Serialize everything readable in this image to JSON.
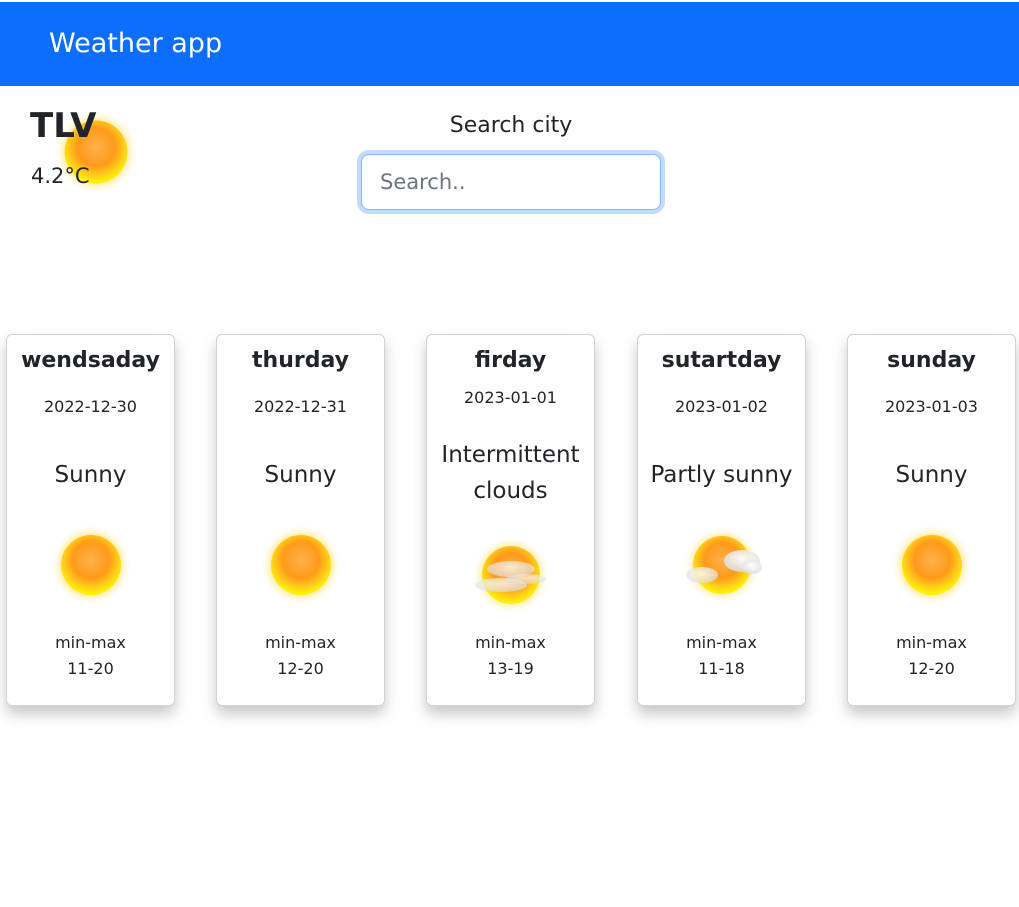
{
  "navbar": {
    "brand": "Weather app"
  },
  "current": {
    "city": "TLV",
    "temperature": "4.2°C",
    "icon": "sun-icon"
  },
  "search": {
    "label": "Search city",
    "placeholder": "Search..",
    "value": ""
  },
  "forecast": [
    {
      "day": "wendsaday",
      "date": "2022-12-30",
      "description": "Sunny",
      "icon": "sun-icon",
      "minmax_label": "min-max",
      "minmax": "11-20"
    },
    {
      "day": "thurday",
      "date": "2022-12-31",
      "description": "Sunny",
      "icon": "sun-icon",
      "minmax_label": "min-max",
      "minmax": "12-20"
    },
    {
      "day": "firday",
      "date": "2023-01-01",
      "description": "Intermittent clouds",
      "icon": "intermittent-clouds-icon",
      "minmax_label": "min-max",
      "minmax": "13-19"
    },
    {
      "day": "sutartday",
      "date": "2023-01-02",
      "description": "Partly sunny",
      "icon": "partly-sunny-icon",
      "minmax_label": "min-max",
      "minmax": "11-18"
    },
    {
      "day": "sunday",
      "date": "2023-01-03",
      "description": "Sunny",
      "icon": "sun-icon",
      "minmax_label": "min-max",
      "minmax": "12-20"
    }
  ],
  "colors": {
    "navbar": "#0d6efd",
    "sun_outer": "#ffcc33",
    "sun_inner": "#ff9900",
    "focus_ring": "#86b7fe"
  }
}
